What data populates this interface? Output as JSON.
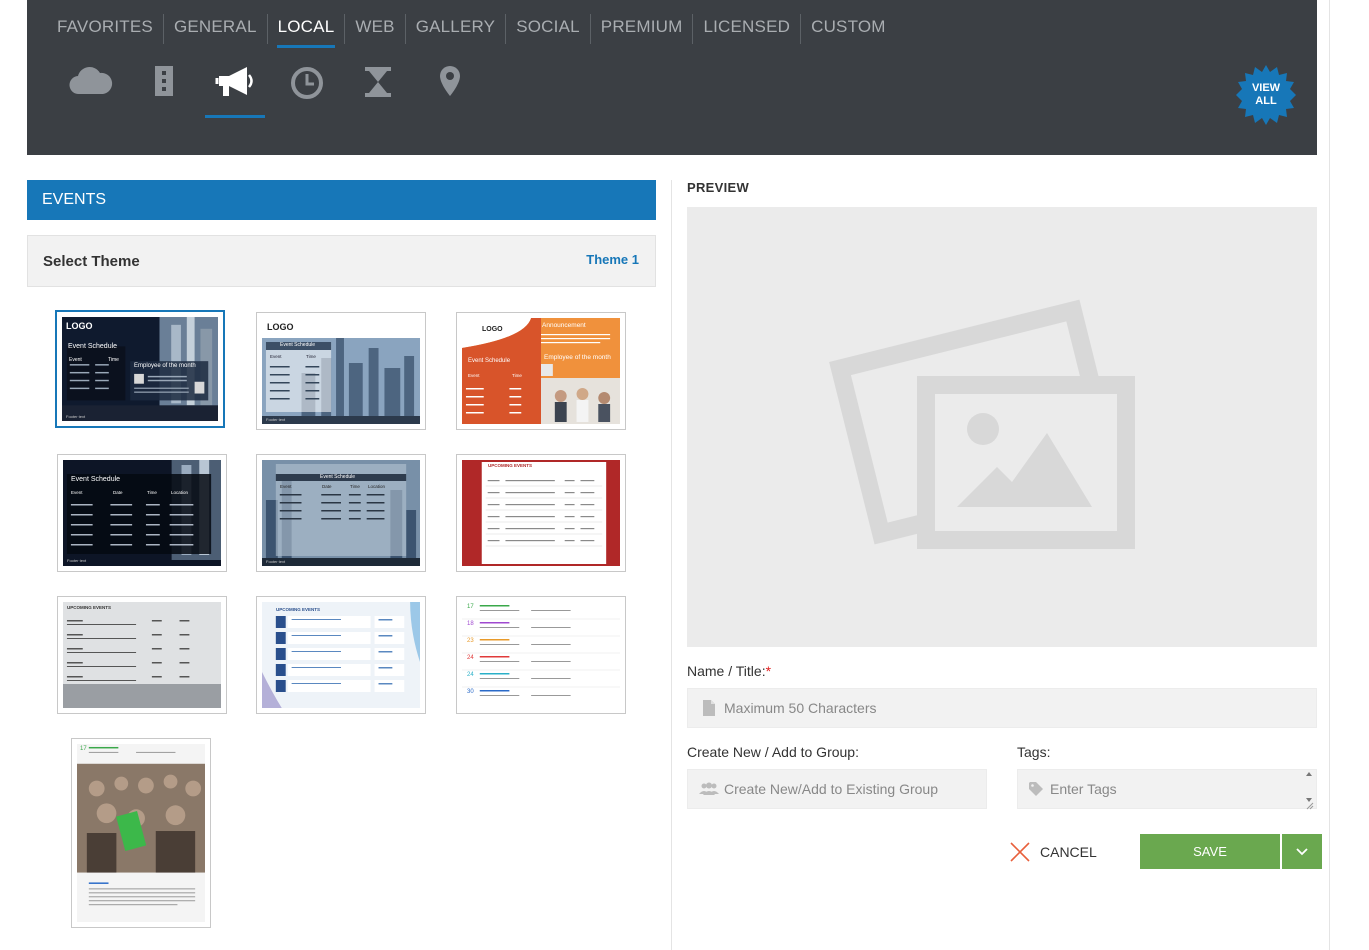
{
  "category_tabs": [
    "FAVORITES",
    "GENERAL",
    "LOCAL",
    "WEB",
    "GALLERY",
    "SOCIAL",
    "PREMIUM",
    "LICENSED",
    "CUSTOM"
  ],
  "active_category": "LOCAL",
  "subnav_icons": [
    "cloud-icon",
    "building-icon",
    "megaphone-icon",
    "clock-icon",
    "hourglass-icon",
    "map-pin-icon"
  ],
  "active_subnav": "megaphone-icon",
  "view_all_label": "VIEW\nALL",
  "section_title": "EVENTS",
  "select_theme": {
    "label": "Select Theme",
    "value": "Theme 1"
  },
  "thumbs": {
    "t1": {
      "logo": "LOGO",
      "schedule": "Event Schedule",
      "event": "Event",
      "time": "Time",
      "emp": "Employee of the month",
      "footer": "Footer text"
    },
    "t2": {
      "logo": "LOGO",
      "schedule": "Event Schedule",
      "event": "Event",
      "time": "Time",
      "footer": "Footer text"
    },
    "t3": {
      "logo": "LOGO",
      "announce": "Announcement",
      "schedule": "Event Schedule",
      "emp": "Employee of the month",
      "event": "Event",
      "time": "Time"
    },
    "t4": {
      "schedule": "Event Schedule",
      "cols": [
        "Event",
        "Date",
        "Time",
        "Location"
      ],
      "footer": "Footer text"
    },
    "t5": {
      "schedule": "Event Schedule",
      "cols": [
        "Event",
        "Date",
        "Time",
        "Location"
      ],
      "footer": "Footer text"
    },
    "t6": {
      "title": "UPCOMING EVENTS"
    },
    "t7": {
      "title": "UPCOMING EVENTS"
    },
    "t8": {
      "title": "UPCOMING EVENTS"
    },
    "t9": {
      "days": [
        "17",
        "18",
        "23",
        "24",
        "24",
        "30"
      ]
    },
    "t10": {
      "day": "17"
    }
  },
  "preview_title": "PREVIEW",
  "name_field": {
    "label": "Name / Title:",
    "required_mark": "*",
    "placeholder": "Maximum 50 Characters"
  },
  "group_field": {
    "label": "Create New / Add to Group:",
    "placeholder": "Create New/Add to Existing Group"
  },
  "tags_field": {
    "label": "Tags:",
    "placeholder": "Enter Tags"
  },
  "cancel_label": "CANCEL",
  "save_label": "SAVE",
  "colors": {
    "header_bg": "#3b3f44",
    "accent_blue": "#1777b8",
    "save_green": "#6aa84f"
  }
}
